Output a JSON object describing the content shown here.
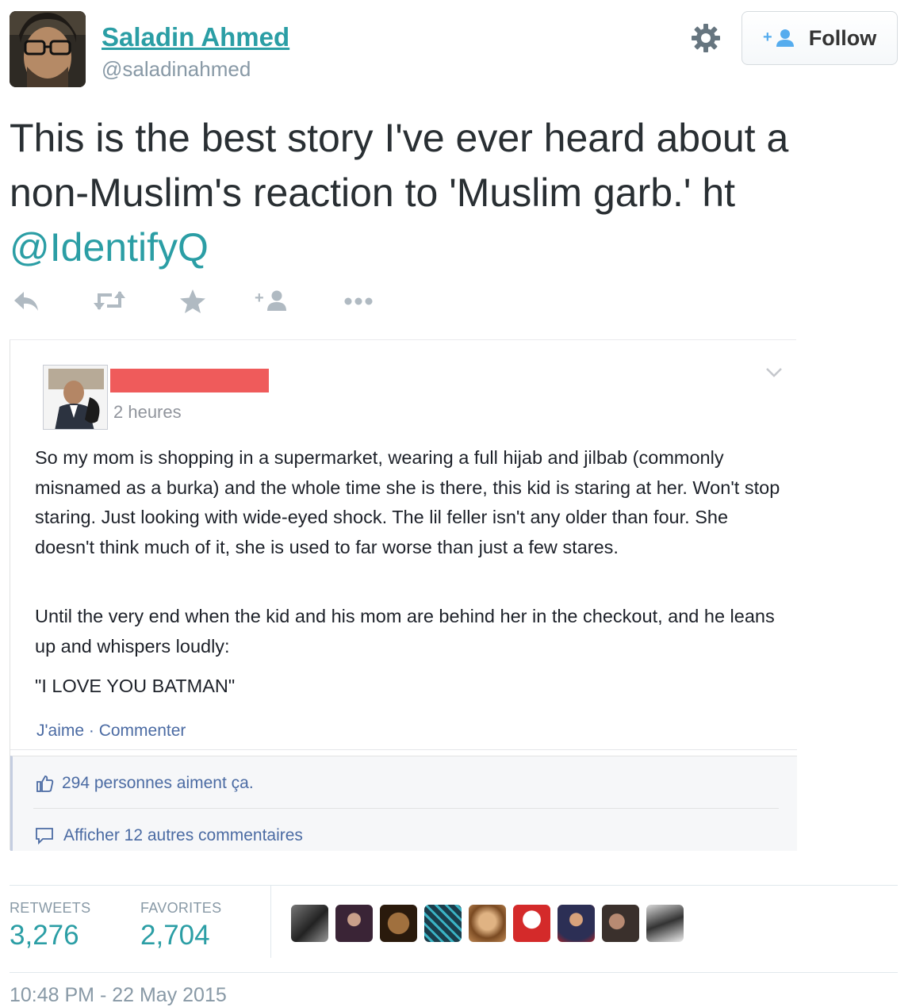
{
  "user": {
    "display_name": "Saladin Ahmed",
    "handle": "@saladinahmed"
  },
  "buttons": {
    "follow_label": "Follow"
  },
  "tweet": {
    "text_line1": "This is the best story I've ever heard about a",
    "text_line2": "non-Muslim's reaction to 'Muslim garb.' ht",
    "mention": "@IdentifyQ"
  },
  "icons": [
    "reply-icon",
    "retweet-icon",
    "favorite-icon",
    "follow-icon",
    "more-icon",
    "gear-icon"
  ],
  "embedded_post": {
    "time": "2 heures",
    "paragraph1": "So my mom is shopping in a supermarket, wearing a full hijab and jilbab (commonly misnamed as a burka) and the whole time she is there, this kid is staring at her. Won't stop staring. Just looking with wide-eyed shock. The lil feller isn't any older than four. She doesn't think much of it, she is used to far worse than just a few stares.",
    "paragraph2": "Until the very end when the kid and his mom are behind her in the checkout, and he leans up and whispers loudly:",
    "quote": "\"I LOVE YOU BATMAN\"",
    "actions": "J'aime · Commenter",
    "likes": "294 personnes aiment ça.",
    "more_comments": "Afficher 12 autres commentaires",
    "redaction_color": "#ef5b5b"
  },
  "stats": {
    "retweets_label": "RETWEETS",
    "retweets_value": "3,276",
    "favorites_label": "FAVORITES",
    "favorites_value": "2,704"
  },
  "timestamp": "10:48 PM - 22 May 2015",
  "colors": {
    "accent": "#2b9ea5",
    "muted": "#8899a6",
    "fb_link": "#4b6ba3"
  }
}
